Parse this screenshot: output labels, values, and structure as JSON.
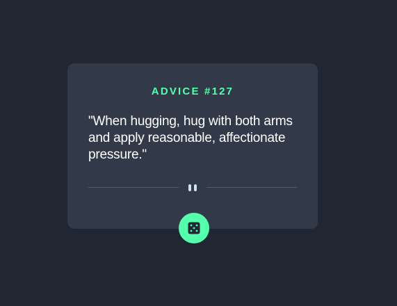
{
  "advice": {
    "id_label": "ADVICE #127",
    "quote": "\"When hugging, hug with both arms and apply reasonable, affectionate pressure.\""
  },
  "icons": {
    "divider": "pause-icon",
    "button": "dice-icon"
  },
  "colors": {
    "background": "#202632",
    "card": "#323a49",
    "accent": "#53ffaa",
    "text": "#ffffff",
    "divider": "#4f5d74",
    "icon_light": "#cee3e9"
  }
}
